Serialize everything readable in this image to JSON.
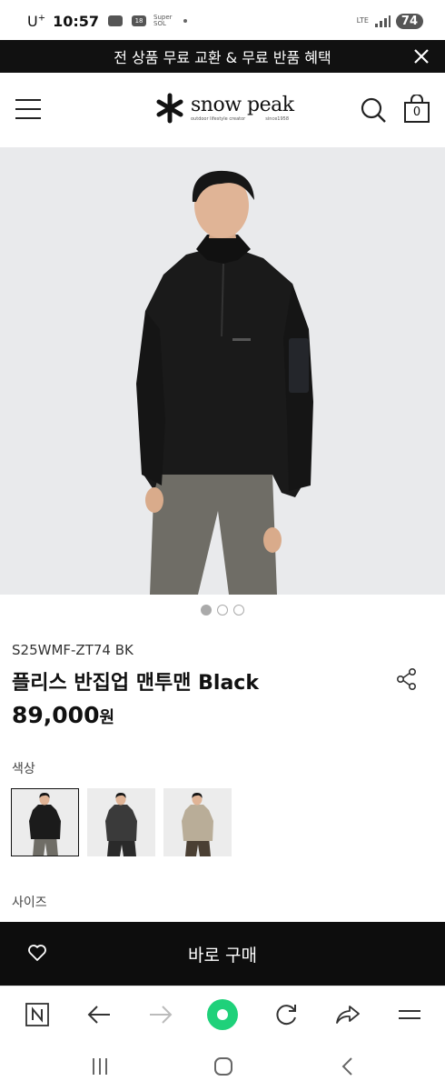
{
  "status_bar": {
    "carrier": "U",
    "carrier_sup": "+",
    "time": "10:57",
    "icon_label": "18",
    "mini_text_1": "Super",
    "mini_text_2": "SOL",
    "network": "LTE",
    "battery": "74"
  },
  "promo": {
    "text": "전 상품 무료 교환 & 무료 반품 혜택"
  },
  "header": {
    "logo_name": "snow peak",
    "logo_tagline": "outdoor lifestyle creator",
    "logo_since": "since1958",
    "cart_count": "0"
  },
  "product": {
    "sku": "S25WMF-ZT74 BK",
    "title": "플리스 반집업 맨투맨 Black",
    "price": "89,000",
    "price_unit": "원",
    "color_label": "색상",
    "size_label": "사이즈",
    "image_count": 3,
    "active_image": 1,
    "swatches": [
      {
        "name": "Black",
        "body_color": "#1b1b1b",
        "pants_color": "#6f6d66",
        "selected": true
      },
      {
        "name": "Charcoal",
        "body_color": "#3a3a3a",
        "pants_color": "#2a2a2a",
        "selected": false
      },
      {
        "name": "Beige",
        "body_color": "#b9ad98",
        "pants_color": "#4a3f33",
        "selected": false
      }
    ]
  },
  "buy_bar": {
    "button_label": "바로 구매"
  },
  "colors": {
    "promo_bg": "#111111",
    "buy_bar_bg": "#0d0d0d",
    "browser_green": "#1fd17a",
    "image_bg": "#e9eaec"
  },
  "browser_icons": [
    "n-logo-icon",
    "back-arrow-icon",
    "forward-arrow-icon",
    "home-green-icon",
    "refresh-icon",
    "share-arrow-icon",
    "menu-icon"
  ],
  "nav_icons": [
    "recent-apps-icon",
    "home-icon",
    "back-icon"
  ]
}
